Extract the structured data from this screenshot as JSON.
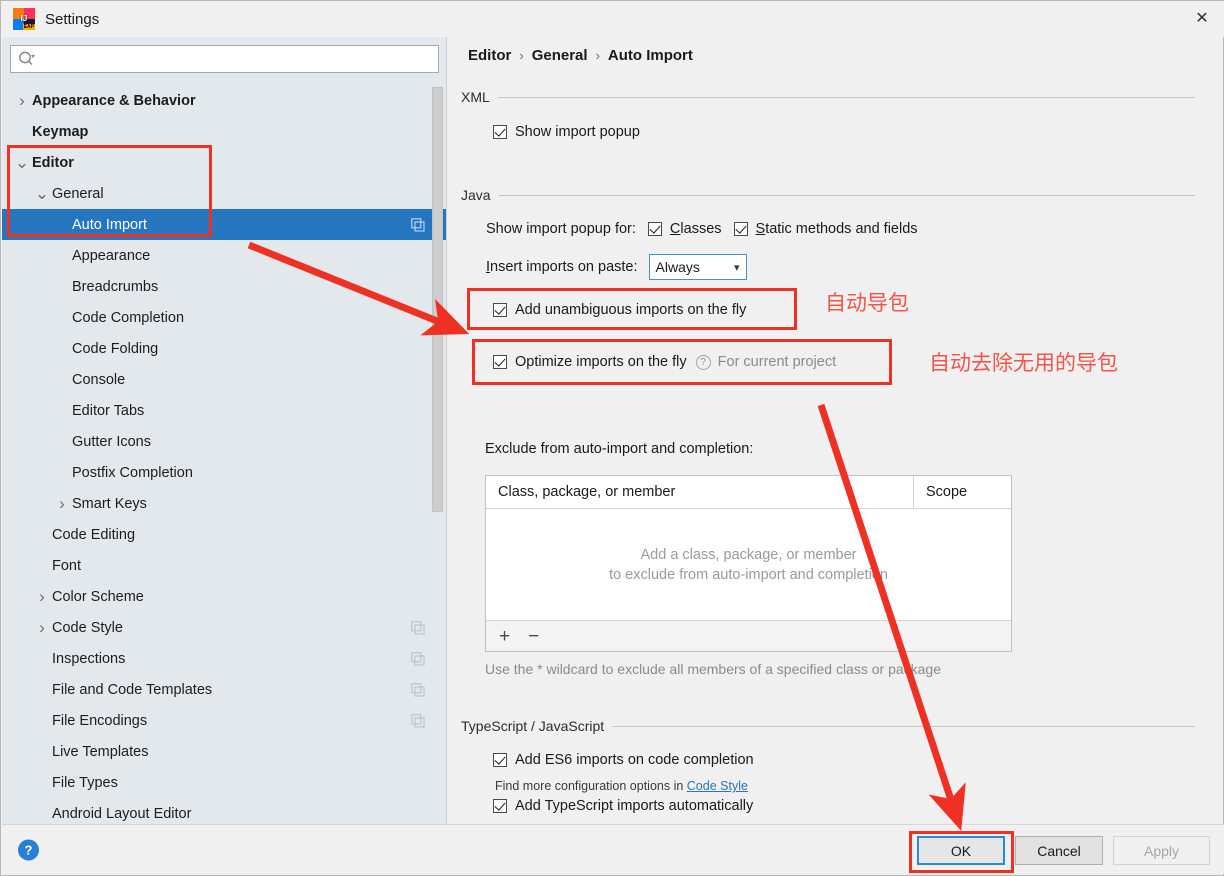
{
  "window": {
    "title": "Settings",
    "app_icon": "intellij-idea-icon",
    "close_label": "✕"
  },
  "search": {
    "placeholder": "",
    "value": "",
    "icon": "search-icon"
  },
  "sidebar": {
    "items": [
      {
        "label": "Appearance & Behavior",
        "depth": 0,
        "twisty": "collapsed",
        "bold": true,
        "selected": false,
        "badge": false
      },
      {
        "label": "Keymap",
        "depth": 0,
        "twisty": "none",
        "bold": true,
        "selected": false,
        "badge": false
      },
      {
        "label": "Editor",
        "depth": 0,
        "twisty": "expanded",
        "bold": true,
        "selected": false,
        "badge": false
      },
      {
        "label": "General",
        "depth": 1,
        "twisty": "expanded",
        "bold": false,
        "selected": false,
        "badge": false
      },
      {
        "label": "Auto Import",
        "depth": 2,
        "twisty": "none",
        "bold": false,
        "selected": true,
        "badge": true
      },
      {
        "label": "Appearance",
        "depth": 2,
        "twisty": "none",
        "bold": false,
        "selected": false,
        "badge": false
      },
      {
        "label": "Breadcrumbs",
        "depth": 2,
        "twisty": "none",
        "bold": false,
        "selected": false,
        "badge": false
      },
      {
        "label": "Code Completion",
        "depth": 2,
        "twisty": "none",
        "bold": false,
        "selected": false,
        "badge": false
      },
      {
        "label": "Code Folding",
        "depth": 2,
        "twisty": "none",
        "bold": false,
        "selected": false,
        "badge": false
      },
      {
        "label": "Console",
        "depth": 2,
        "twisty": "none",
        "bold": false,
        "selected": false,
        "badge": false
      },
      {
        "label": "Editor Tabs",
        "depth": 2,
        "twisty": "none",
        "bold": false,
        "selected": false,
        "badge": false
      },
      {
        "label": "Gutter Icons",
        "depth": 2,
        "twisty": "none",
        "bold": false,
        "selected": false,
        "badge": false
      },
      {
        "label": "Postfix Completion",
        "depth": 2,
        "twisty": "none",
        "bold": false,
        "selected": false,
        "badge": false
      },
      {
        "label": "Smart Keys",
        "depth": 2,
        "twisty": "collapsed",
        "bold": false,
        "selected": false,
        "badge": false
      },
      {
        "label": "Code Editing",
        "depth": 1,
        "twisty": "none",
        "bold": false,
        "selected": false,
        "badge": false
      },
      {
        "label": "Font",
        "depth": 1,
        "twisty": "none",
        "bold": false,
        "selected": false,
        "badge": false
      },
      {
        "label": "Color Scheme",
        "depth": 1,
        "twisty": "collapsed",
        "bold": false,
        "selected": false,
        "badge": false
      },
      {
        "label": "Code Style",
        "depth": 1,
        "twisty": "collapsed",
        "bold": false,
        "selected": false,
        "badge": true
      },
      {
        "label": "Inspections",
        "depth": 1,
        "twisty": "none",
        "bold": false,
        "selected": false,
        "badge": true
      },
      {
        "label": "File and Code Templates",
        "depth": 1,
        "twisty": "none",
        "bold": false,
        "selected": false,
        "badge": true
      },
      {
        "label": "File Encodings",
        "depth": 1,
        "twisty": "none",
        "bold": false,
        "selected": false,
        "badge": true
      },
      {
        "label": "Live Templates",
        "depth": 1,
        "twisty": "none",
        "bold": false,
        "selected": false,
        "badge": false
      },
      {
        "label": "File Types",
        "depth": 1,
        "twisty": "none",
        "bold": false,
        "selected": false,
        "badge": false
      },
      {
        "label": "Android Layout Editor",
        "depth": 1,
        "twisty": "none",
        "bold": false,
        "selected": false,
        "badge": false
      }
    ]
  },
  "breadcrumb": {
    "part1": "Editor",
    "part2": "General",
    "part3": "Auto Import",
    "separator": "›"
  },
  "xml": {
    "group_title": "XML",
    "show_import_popup": {
      "label": "Show import popup",
      "checked": true
    }
  },
  "java": {
    "group_title": "Java",
    "show_popup_for_label": "Show import popup for:",
    "classes": {
      "label": "Classes",
      "mnemonic": "C",
      "checked": true
    },
    "static_methods": {
      "label": "Static methods and fields",
      "mnemonic": "S",
      "checked": true
    },
    "insert_on_paste_label": "Insert imports on paste:",
    "insert_on_paste_value": "Always",
    "add_unambiguous": {
      "label": "Add unambiguous imports on the fly",
      "checked": true
    },
    "optimize_imports": {
      "label": "Optimize imports on the fly",
      "checked": true,
      "scope": "For current project",
      "help_icon": "help-circle-icon"
    },
    "exclude_label": "Exclude from auto-import and completion:",
    "table": {
      "columns": [
        "Class, package, or member",
        "Scope"
      ],
      "rows": [],
      "empty_line1": "Add a class, package, or member",
      "empty_line2": "to exclude from auto-import and completion",
      "add_button": "+",
      "remove_button": "−"
    },
    "hint": "Use the * wildcard to exclude all members of a specified class or package"
  },
  "typescript": {
    "group_title": "TypeScript / JavaScript",
    "add_es6": {
      "label": "Add ES6 imports on code completion",
      "checked": true
    },
    "config_note_prefix": "Find more configuration options in ",
    "config_note_link": "Code Style",
    "add_ts": {
      "label": "Add TypeScript imports automatically",
      "checked": true
    }
  },
  "buttons": {
    "help": "?",
    "ok": "OK",
    "cancel": "Cancel",
    "apply": "Apply"
  },
  "annotations": {
    "note_auto_import": "自动导包",
    "note_remove_unused": "自动去除无用的导包",
    "highlight_color": "#ef3124",
    "text_color": "#f2544a"
  }
}
